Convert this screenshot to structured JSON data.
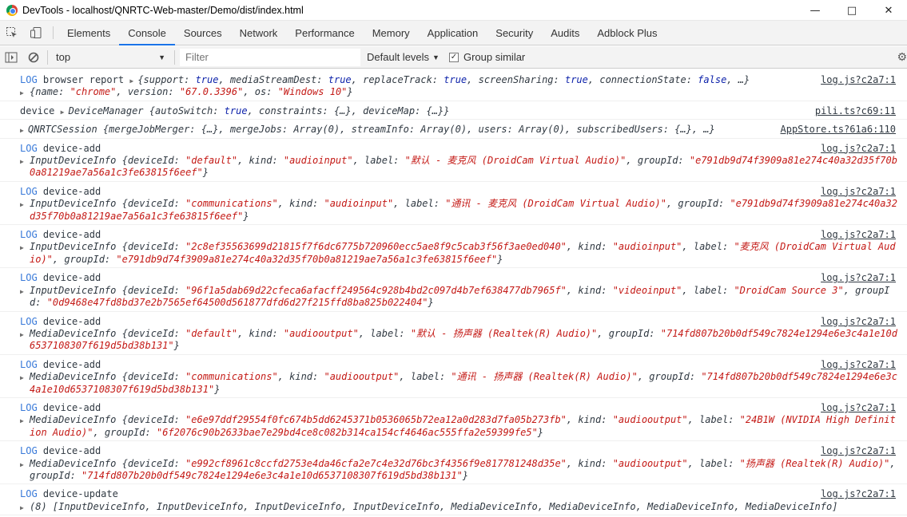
{
  "window": {
    "title": "DevTools - localhost/QNRTC-Web-master/Demo/dist/index.html",
    "minimize": "—",
    "maximize": "□",
    "close": "✕"
  },
  "tabs": [
    {
      "label": "Elements"
    },
    {
      "label": "Console"
    },
    {
      "label": "Sources"
    },
    {
      "label": "Network"
    },
    {
      "label": "Performance"
    },
    {
      "label": "Memory"
    },
    {
      "label": "Application"
    },
    {
      "label": "Security"
    },
    {
      "label": "Audits"
    },
    {
      "label": "Adblock Plus"
    }
  ],
  "active_tab": "Console",
  "toolbar": {
    "context": "top",
    "filter_placeholder": "Filter",
    "levels": "Default levels",
    "group_similar": "Group similar",
    "group_similar_checked": true
  },
  "colors": {
    "log_level": "#3879d9",
    "string": "#c41a16",
    "boolean": "#0d22aa",
    "active_tab": "#1a73e8"
  },
  "messages": [
    {
      "level": "LOG",
      "text": "browser report",
      "obj1": "{support: true, mediaStreamDest: true, replaceTrack: true, screenSharing: true, connectionState: false, …}",
      "obj2": "{name: \"chrome\", version: \"67.0.3396\", os: \"Windows 10\"}",
      "source": "log.js?c2a7:1"
    },
    {
      "level": "",
      "text": "device",
      "obj1": "DeviceManager {autoSwitch: true, constraints: {…}, deviceMap: {…}}",
      "source": "pili.ts?c69:11"
    },
    {
      "level": "",
      "text": "",
      "obj1": "QNRTCSession {mergeJobMerger: {…}, mergeJobs: Array(0), streamInfo: Array(0), users: Array(0), subscribedUsers: {…}, …}",
      "source": "AppStore.ts?61a6:110"
    },
    {
      "level": "LOG",
      "text": "device-add",
      "obj2": "InputDeviceInfo {deviceId: \"default\", kind: \"audioinput\", label: \"默认 - 麦克风 (DroidCam Virtual Audio)\", groupId: \"e791db9d74f3909a81e274c40a32d35f70b0a81219ae7a56a1c3fe63815f6eef\"}",
      "source": "log.js?c2a7:1"
    },
    {
      "level": "LOG",
      "text": "device-add",
      "obj2": "InputDeviceInfo {deviceId: \"communications\", kind: \"audioinput\", label: \"通讯 - 麦克风 (DroidCam Virtual Audio)\", groupId: \"e791db9d74f3909a81e274c40a32d35f70b0a81219ae7a56a1c3fe63815f6eef\"}",
      "source": "log.js?c2a7:1"
    },
    {
      "level": "LOG",
      "text": "device-add",
      "obj2": "InputDeviceInfo {deviceId: \"2c8ef35563699d21815f7f6dc6775b720960ecc5ae8f9c5cab3f56f3ae0ed040\", kind: \"audioinput\", label: \"麦克风 (DroidCam Virtual Audio)\", groupId: \"e791db9d74f3909a81e274c40a32d35f70b0a81219ae7a56a1c3fe63815f6eef\"}",
      "source": "log.js?c2a7:1"
    },
    {
      "level": "LOG",
      "text": "device-add",
      "obj2": "InputDeviceInfo {deviceId: \"96f1a5dab69d22cfeca6afacff249564c928b4bd2c097d4b7ef638477db7965f\", kind: \"videoinput\", label: \"DroidCam Source 3\", groupId: \"0d9468e47fd8bd37e2b7565ef64500d561877dfd6d27f215ffd8ba825b022404\"}",
      "source": "log.js?c2a7:1"
    },
    {
      "level": "LOG",
      "text": "device-add",
      "obj2": "MediaDeviceInfo {deviceId: \"default\", kind: \"audiooutput\", label: \"默认 - 扬声器 (Realtek(R) Audio)\", groupId: \"714fd807b20b0df549c7824e1294e6e3c4a1e10d6537108307f619d5bd38b131\"}",
      "source": "log.js?c2a7:1"
    },
    {
      "level": "LOG",
      "text": "device-add",
      "obj2": "MediaDeviceInfo {deviceId: \"communications\", kind: \"audiooutput\", label: \"通讯 - 扬声器 (Realtek(R) Audio)\", groupId: \"714fd807b20b0df549c7824e1294e6e3c4a1e10d6537108307f619d5bd38b131\"}",
      "source": "log.js?c2a7:1"
    },
    {
      "level": "LOG",
      "text": "device-add",
      "obj2": "MediaDeviceInfo {deviceId: \"e6e97ddf29554f0fc674b5dd6245371b0536065b72ea12a0d283d7fa05b273fb\", kind: \"audiooutput\", label: \"24B1W (NVIDIA High Definition Audio)\", groupId: \"6f2076c90b2633bae7e29bd4ce8c082b314ca154cf4646ac555ffa2e59399fe5\"}",
      "source": "log.js?c2a7:1"
    },
    {
      "level": "LOG",
      "text": "device-add",
      "obj2": "MediaDeviceInfo {deviceId: \"e992cf8961c8ccfd2753e4da46cfa2e7c4e32d76bc3f4356f9e817781248d35e\", kind: \"audiooutput\", label: \"扬声器 (Realtek(R) Audio)\", groupId: \"714fd807b20b0df549c7824e1294e6e3c4a1e10d6537108307f619d5bd38b131\"}",
      "source": "log.js?c2a7:1"
    },
    {
      "level": "LOG",
      "text": "device-update",
      "obj2": "(8) [InputDeviceInfo, InputDeviceInfo, InputDeviceInfo, InputDeviceInfo, MediaDeviceInfo, MediaDeviceInfo, MediaDeviceInfo, MediaDeviceInfo]",
      "source": "log.js?c2a7:1"
    }
  ],
  "prompt": "›"
}
